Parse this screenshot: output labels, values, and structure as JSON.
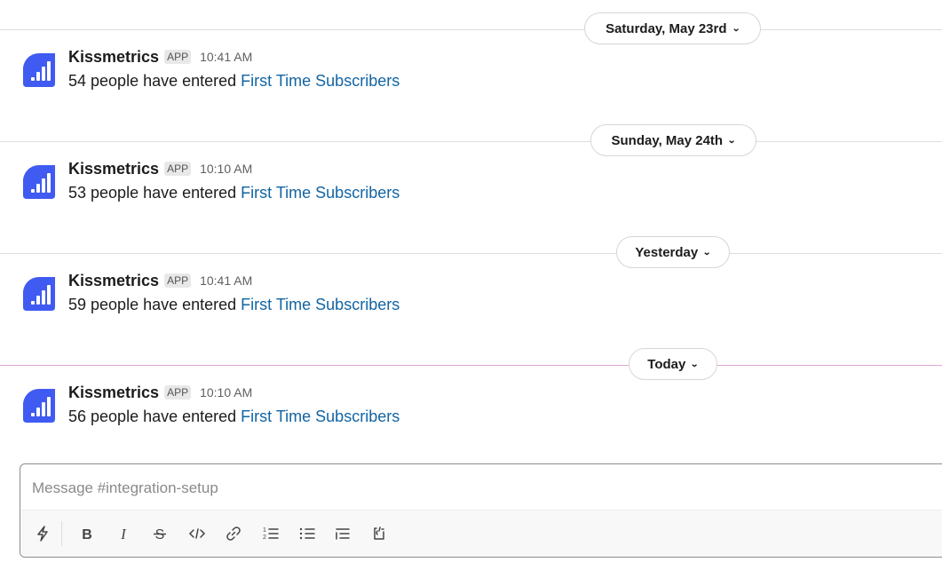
{
  "days": [
    {
      "date_label": "Saturday, May 23rd",
      "message": {
        "sender": "Kissmetrics",
        "badge": "APP",
        "time": "10:41 AM",
        "text": "54 people have entered ",
        "link": "First Time Subscribers"
      }
    },
    {
      "date_label": "Sunday, May 24th",
      "message": {
        "sender": "Kissmetrics",
        "badge": "APP",
        "time": "10:10 AM",
        "text": "53 people have entered ",
        "link": "First Time Subscribers"
      }
    },
    {
      "date_label": "Yesterday",
      "message": {
        "sender": "Kissmetrics",
        "badge": "APP",
        "time": "10:41 AM",
        "text": "59 people have entered ",
        "link": "First Time Subscribers"
      }
    },
    {
      "date_label": "Today",
      "message": {
        "sender": "Kissmetrics",
        "badge": "APP",
        "time": "10:10 AM",
        "text": "56 people have entered ",
        "link": "First Time Subscribers"
      }
    }
  ],
  "composer": {
    "placeholder": "Message #integration-setup"
  },
  "toolbar_icons": [
    "shortcuts-lightning-icon",
    "bold-icon",
    "italic-icon",
    "strikethrough-icon",
    "code-icon",
    "link-icon",
    "ordered-list-icon",
    "bulleted-list-icon",
    "blockquote-icon",
    "code-block-icon"
  ],
  "colors": {
    "link": "#1264a3",
    "avatar": "#3f5bf2",
    "today_divider": "#e3a7cf"
  }
}
